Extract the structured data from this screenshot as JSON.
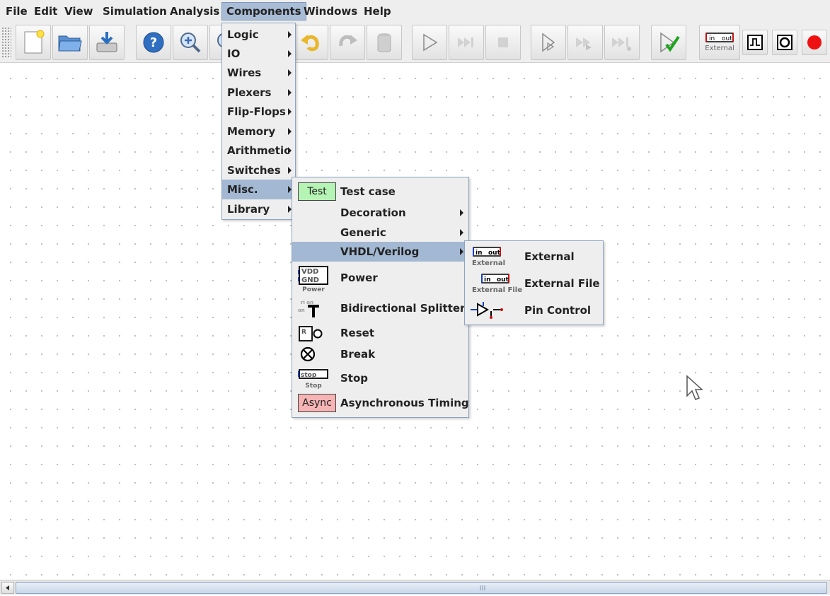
{
  "menubar": {
    "items": [
      {
        "label": "File"
      },
      {
        "label": "Edit"
      },
      {
        "label": "View"
      },
      {
        "label": "Simulation"
      },
      {
        "label": "Analysis"
      },
      {
        "label": "Components"
      },
      {
        "label": "Windows"
      },
      {
        "label": "Help"
      }
    ],
    "active": "Components"
  },
  "toolbar": {
    "buttons": [
      {
        "icon": "new-file-icon"
      },
      {
        "icon": "open-folder-icon"
      },
      {
        "icon": "save-icon"
      },
      {
        "icon": "help-icon"
      },
      {
        "icon": "zoom-in-icon"
      },
      {
        "icon": "zoom-out-icon"
      },
      {
        "icon": "undo-icon"
      },
      {
        "icon": "redo-icon"
      },
      {
        "icon": "delete-icon"
      },
      {
        "icon": "play-icon"
      },
      {
        "icon": "step-forward-icon"
      },
      {
        "icon": "stop-icon"
      },
      {
        "icon": "micro-step-icon"
      },
      {
        "icon": "fast-forward-icon"
      },
      {
        "icon": "run-to-break-icon"
      },
      {
        "icon": "check-icon"
      },
      {
        "icon": "external-component-icon"
      },
      {
        "icon": "clock-icon"
      },
      {
        "icon": "probe-icon"
      },
      {
        "icon": "record-icon"
      }
    ],
    "external_in": "in",
    "external_out": "out",
    "external_label": "External"
  },
  "components_menu": {
    "items": [
      {
        "label": "Logic"
      },
      {
        "label": "IO"
      },
      {
        "label": "Wires"
      },
      {
        "label": "Plexers"
      },
      {
        "label": "Flip-Flops"
      },
      {
        "label": "Memory"
      },
      {
        "label": "Arithmetic"
      },
      {
        "label": "Switches"
      },
      {
        "label": "Misc."
      },
      {
        "label": "Library"
      }
    ],
    "selected": "Misc."
  },
  "misc_menu": {
    "items": [
      {
        "label": "Test case",
        "icon": "test-case-icon",
        "icon_text": "Test"
      },
      {
        "label": "Decoration",
        "submenu": true
      },
      {
        "label": "Generic",
        "submenu": true
      },
      {
        "label": "VHDL/Verilog",
        "submenu": true
      },
      {
        "label": "Power",
        "icon": "power-icon",
        "icon_lines": [
          "VDD",
          "GND"
        ],
        "icon_caption": "Power"
      },
      {
        "label": "Bidirectional Splitter",
        "icon": "splitter-icon"
      },
      {
        "label": "Reset",
        "icon": "reset-icon",
        "icon_text": "R"
      },
      {
        "label": "Break",
        "icon": "break-icon"
      },
      {
        "label": "Stop",
        "icon": "stop-component-icon",
        "icon_text": "stop",
        "icon_caption": "Stop"
      },
      {
        "label": "Asynchronous Timing",
        "icon": "async-icon",
        "icon_text": "Async"
      }
    ],
    "selected": "VHDL/Verilog"
  },
  "vhdl_menu": {
    "items": [
      {
        "label": "External",
        "icon": "external-icon",
        "icon_caption": "External",
        "in": "in",
        "out": "out"
      },
      {
        "label": "External File",
        "icon": "external-file-icon",
        "icon_caption": "External File",
        "in": "in",
        "out": "out"
      },
      {
        "label": "Pin Control",
        "icon": "pin-control-icon"
      }
    ]
  },
  "colors": {
    "menu_bg": "#eeeeee",
    "menu_selected": "#a3b8d3",
    "menu_border": "#8ca4c2",
    "test_green": "#b6f4b6",
    "async_pink": "#f6b4b4",
    "record_red": "#ee1111",
    "external_red": "#cc1111"
  }
}
